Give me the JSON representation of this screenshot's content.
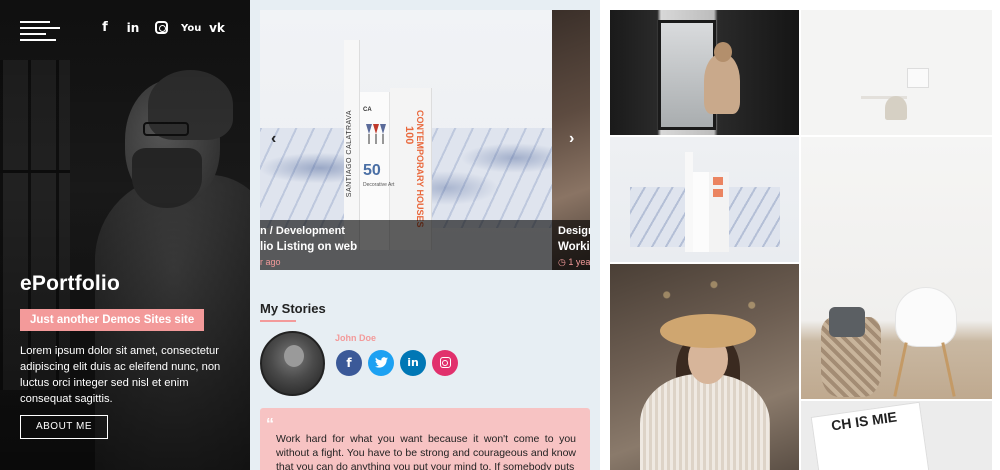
{
  "sidebar": {
    "social": [
      {
        "name": "facebook-icon",
        "glyph": "f"
      },
      {
        "name": "linkedin-icon",
        "glyph": "in"
      },
      {
        "name": "instagram-icon",
        "glyph": ""
      },
      {
        "name": "youtube-icon",
        "glyph": "You"
      },
      {
        "name": "vk-icon",
        "glyph": "vk"
      }
    ],
    "site_title": "ePortfolio",
    "tagline": "Just another Demos Sites site",
    "bio": "Lorem ipsum dolor sit amet, consectetur adipiscing elit duis ac eleifend nunc, non luctus orci integer sed nisl et enim consequat sagittis.",
    "about_button": "ABOUT ME"
  },
  "carousel": {
    "slides": [
      {
        "category": "n  /  Development",
        "title": "lio Listing on web",
        "date": "r ago"
      },
      {
        "category": "Design",
        "title": "Worki",
        "date": "◷ 1 year"
      }
    ],
    "prev_icon": "‹",
    "next_icon": "›",
    "book_spine": "SANTIAGO CALATRAVA",
    "book_ca": "CA",
    "book_50": "50",
    "book_decor": "Decorative Art",
    "book_100": "100",
    "book_houses": "CONTEMPORARY HOUSES",
    "close_mark": "✖"
  },
  "stories": {
    "heading": "My Stories",
    "author_name": "John Doe",
    "quote": "Work hard for what you want because it won't come to you without a fight. You have to be strong and courageous and know that you can do anything you put your mind to. If somebody puts"
  },
  "grid": {
    "book_text": "CH IS MIE"
  },
  "colors": {
    "accent": "#f39a9a",
    "facebook": "#3b5998",
    "twitter": "#1da1f2",
    "linkedin": "#0077b5",
    "instagram": "#e1306c",
    "middle_bg": "#e7eef3"
  }
}
